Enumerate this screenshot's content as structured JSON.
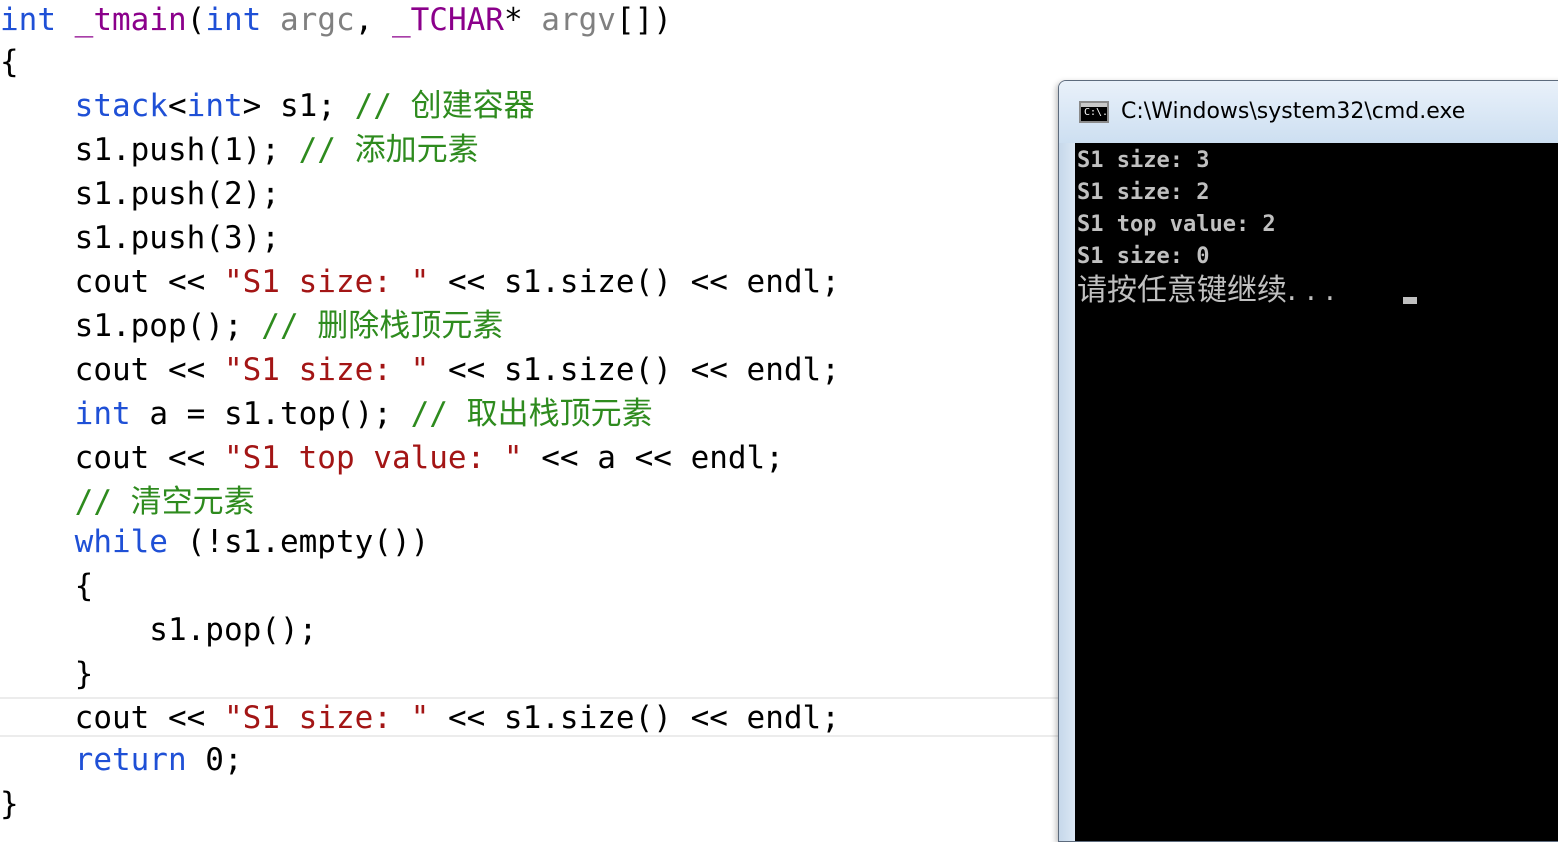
{
  "colors": {
    "keyword": "#1f50d6",
    "string": "#a31515",
    "comment": "#2e8b1e",
    "macro": "#8b008b",
    "param": "#808080",
    "plain": "#000000"
  },
  "editor": {
    "lines": [
      {
        "tokens": [
          {
            "text": "int",
            "kind": "keyword"
          },
          {
            "text": " ",
            "kind": "plain"
          },
          {
            "text": "_tmain",
            "kind": "macro"
          },
          {
            "text": "(",
            "kind": "plain"
          },
          {
            "text": "int",
            "kind": "keyword"
          },
          {
            "text": " ",
            "kind": "plain"
          },
          {
            "text": "argc",
            "kind": "param"
          },
          {
            "text": ", ",
            "kind": "plain"
          },
          {
            "text": "_TCHAR",
            "kind": "macro"
          },
          {
            "text": "* ",
            "kind": "plain"
          },
          {
            "text": "argv",
            "kind": "param"
          },
          {
            "text": "[])",
            "kind": "plain"
          }
        ]
      },
      {
        "tokens": [
          {
            "text": "{",
            "kind": "plain"
          }
        ]
      },
      {
        "tokens": [
          {
            "text": "    ",
            "kind": "plain"
          },
          {
            "text": "stack",
            "kind": "keyword"
          },
          {
            "text": "<",
            "kind": "plain"
          },
          {
            "text": "int",
            "kind": "keyword"
          },
          {
            "text": "> s1; ",
            "kind": "plain"
          },
          {
            "text": "// 创建容器",
            "kind": "comment"
          }
        ]
      },
      {
        "tokens": [
          {
            "text": "    s1.push(1); ",
            "kind": "plain"
          },
          {
            "text": "// 添加元素",
            "kind": "comment"
          }
        ]
      },
      {
        "tokens": [
          {
            "text": "    s1.push(2);",
            "kind": "plain"
          }
        ]
      },
      {
        "tokens": [
          {
            "text": "    s1.push(3);",
            "kind": "plain"
          }
        ]
      },
      {
        "tokens": [
          {
            "text": "    cout << ",
            "kind": "plain"
          },
          {
            "text": "\"S1 size: \"",
            "kind": "string"
          },
          {
            "text": " << s1.size() << endl;",
            "kind": "plain"
          }
        ]
      },
      {
        "tokens": [
          {
            "text": "    s1.pop(); ",
            "kind": "plain"
          },
          {
            "text": "// 删除栈顶元素",
            "kind": "comment"
          }
        ]
      },
      {
        "tokens": [
          {
            "text": "    cout << ",
            "kind": "plain"
          },
          {
            "text": "\"S1 size: \"",
            "kind": "string"
          },
          {
            "text": " << s1.size() << endl;",
            "kind": "plain"
          }
        ]
      },
      {
        "tokens": [
          {
            "text": "    ",
            "kind": "plain"
          },
          {
            "text": "int",
            "kind": "keyword"
          },
          {
            "text": " a = s1.top(); ",
            "kind": "plain"
          },
          {
            "text": "// 取出栈顶元素",
            "kind": "comment"
          }
        ]
      },
      {
        "tokens": [
          {
            "text": "    cout << ",
            "kind": "plain"
          },
          {
            "text": "\"S1 top value: \"",
            "kind": "string"
          },
          {
            "text": " << a << endl;",
            "kind": "plain"
          }
        ]
      },
      {
        "tokens": [
          {
            "text": "    ",
            "kind": "plain"
          },
          {
            "text": "// 清空元素",
            "kind": "comment"
          }
        ]
      },
      {
        "tokens": [
          {
            "text": "    ",
            "kind": "plain"
          },
          {
            "text": "while",
            "kind": "keyword"
          },
          {
            "text": " (!s1.empty())",
            "kind": "plain"
          }
        ]
      },
      {
        "tokens": [
          {
            "text": "    {",
            "kind": "plain"
          }
        ]
      },
      {
        "tokens": [
          {
            "text": "        s1.pop();",
            "kind": "plain"
          }
        ]
      },
      {
        "tokens": [
          {
            "text": "    }",
            "kind": "plain"
          }
        ]
      },
      {
        "tokens": [
          {
            "text": "    cout << ",
            "kind": "plain"
          },
          {
            "text": "\"S1 size: \"",
            "kind": "string"
          },
          {
            "text": " << s1.size() << endl;",
            "kind": "plain"
          }
        ]
      },
      {
        "tokens": [
          {
            "text": "    ",
            "kind": "plain"
          },
          {
            "text": "return",
            "kind": "keyword"
          },
          {
            "text": " 0;",
            "kind": "plain"
          }
        ]
      },
      {
        "tokens": [
          {
            "text": "}",
            "kind": "plain"
          }
        ]
      }
    ]
  },
  "cmd": {
    "title": "C:\\Windows\\system32\\cmd.exe",
    "icon_label": "C:\\.",
    "output": [
      "S1 size: 3",
      "S1 size: 2",
      "S1 top value: 2",
      "S1 size: 0"
    ],
    "prompt": "请按任意键继续. . ."
  }
}
